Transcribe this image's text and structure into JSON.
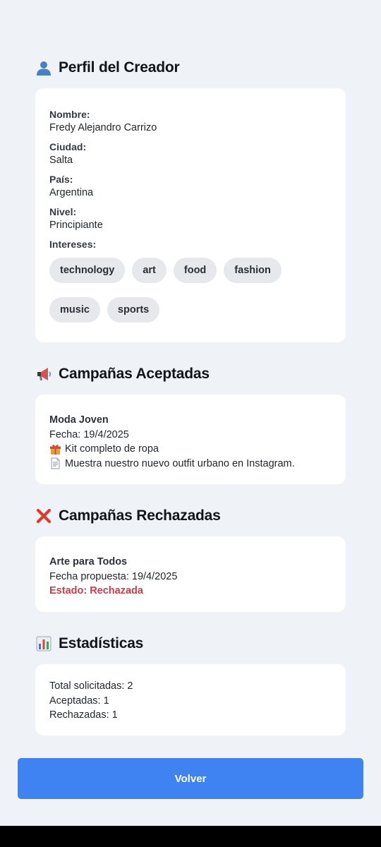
{
  "profile": {
    "title": "Perfil del Creador",
    "icon": "person-icon",
    "fields": [
      {
        "label": "Nombre:",
        "value": "Fredy Alejandro Carrizo"
      },
      {
        "label": "Ciudad:",
        "value": "Salta"
      },
      {
        "label": "País:",
        "value": "Argentina"
      },
      {
        "label": "Nivel:",
        "value": "Principiante"
      }
    ],
    "interests_label": "Intereses:",
    "interests": [
      "technology",
      "art",
      "food",
      "fashion",
      "music",
      "sports"
    ]
  },
  "accepted": {
    "title": "Campañas Aceptadas",
    "icon": "megaphone-icon",
    "campaign_name": "Moda Joven",
    "date": "Fecha: 19/4/2025",
    "reward": "Kit completo de ropa",
    "reward_icon": "gift-icon",
    "description": "Muestra nuestro nuevo outfit urbano en Instagram.",
    "description_icon": "document-icon"
  },
  "rejected": {
    "title": "Campañas Rechazadas",
    "icon": "cross-mark-icon",
    "campaign_name": "Arte para Todos",
    "date": "Fecha propuesta: 19/4/2025",
    "status": "Estado: Rechazada",
    "status_color": "#d13a4a"
  },
  "stats": {
    "title": "Estadísticas",
    "icon": "bar-chart-icon",
    "total": "Total solicitadas: 2",
    "accepted": "Aceptadas: 1",
    "rejected": "Rechazadas: 1"
  },
  "back_button": {
    "label": "Volver",
    "color": "#3f83f2"
  },
  "colors": {
    "background": "#eff3f8",
    "card": "#ffffff",
    "tag": "#e6e8eb"
  }
}
